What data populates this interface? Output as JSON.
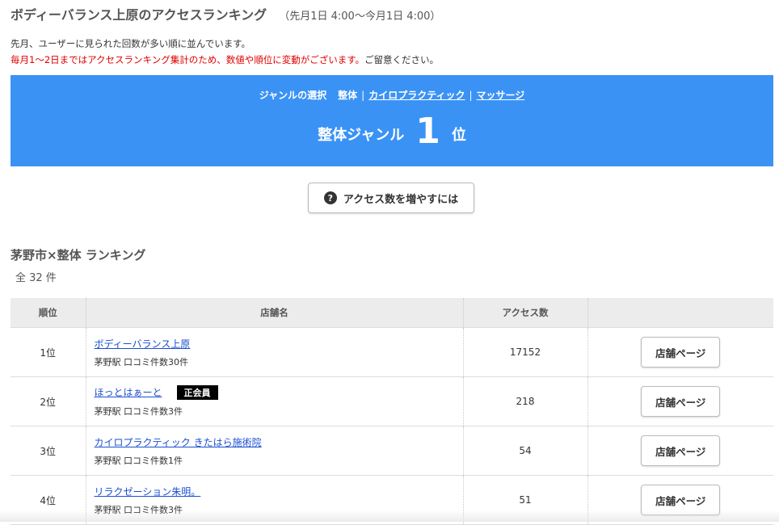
{
  "header": {
    "title": "ボディーバランス上原のアクセスランキング",
    "period": "（先月1日 4:00〜今月1日 4:00）"
  },
  "intro": {
    "line1": "先月、ユーザーに見られた回数が多い順に並んでいます。",
    "warning": "毎月1〜2日まではアクセスランキング集計のため、数値や順位に変動がございます。",
    "note": "ご留意ください。"
  },
  "banner": {
    "genre_label": "ジャンルの選択",
    "genres": [
      "整体",
      "カイロプラクティック",
      "マッサージ"
    ],
    "separator": "|",
    "rank_genre": "整体ジャンル",
    "rank_number": "1",
    "rank_unit": "位",
    "bg_color": "#3a92f5"
  },
  "access_button": {
    "icon": "question-circle-icon",
    "label": "アクセス数を増やすには"
  },
  "ranking": {
    "title": "茅野市×整体 ランキング",
    "total": "全 32 件",
    "columns": [
      "順位",
      "店舗名",
      "アクセス数",
      ""
    ],
    "rows": [
      {
        "rank": "1位",
        "name": "ボディーバランス上原",
        "sub": "茅野駅 口コミ件数30件",
        "badge": "",
        "access": "17152",
        "button": "店舗ページ"
      },
      {
        "rank": "2位",
        "name": "ほっとはぁーと",
        "sub": "茅野駅 口コミ件数3件",
        "badge": "正会員",
        "access": "218",
        "button": "店舗ページ"
      },
      {
        "rank": "3位",
        "name": "カイロプラクティック きたはら施術院",
        "sub": "茅野駅 口コミ件数1件",
        "badge": "",
        "access": "54",
        "button": "店舗ページ"
      },
      {
        "rank": "4位",
        "name": "リラクゼーション朱明。",
        "sub": "茅野駅 口コミ件数3件",
        "badge": "",
        "access": "51",
        "button": "店舗ページ"
      }
    ]
  }
}
